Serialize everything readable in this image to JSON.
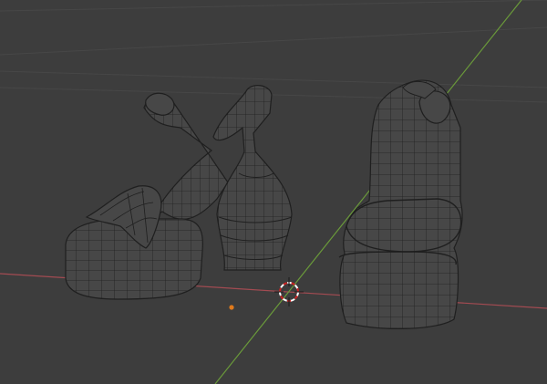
{
  "viewport": {
    "background": "#3d3d3d",
    "grid_color": "#4a4a4a",
    "x_axis_color": "#a34b52",
    "y_axis_color": "#6a9a3a",
    "mesh_wire_color": "#1f1f1f",
    "mesh_face_color": "#474747",
    "origin_color": "#e07a1c"
  },
  "icons": {
    "cursor": "3d-cursor-icon",
    "origin": "object-origin-icon"
  }
}
